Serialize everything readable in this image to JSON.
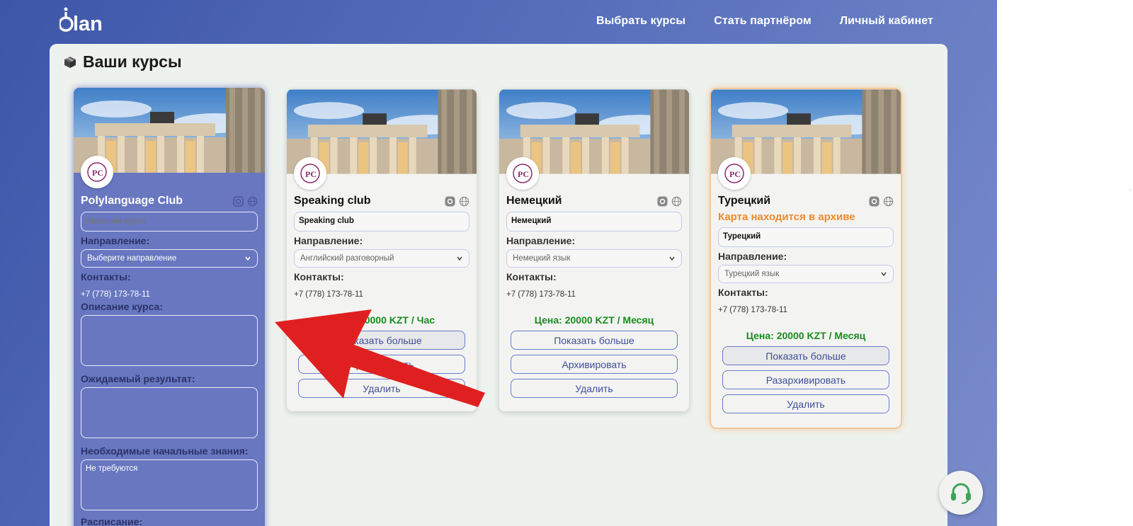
{
  "header": {
    "logo_text": "olan",
    "nav": [
      "Выбрать курсы",
      "Стать партнёром",
      "Личный кабинет"
    ]
  },
  "page": {
    "title": "Ваши курсы",
    "title_icon": "package-icon"
  },
  "labels": {
    "direction": "Направление:",
    "contacts": "Контакты:",
    "description": "Описание курса:",
    "expected_result": "Ожидаемый результат:",
    "prior_knowledge": "Необходимые начальные знания:",
    "schedule": "Расписание:",
    "show_more": "Показать больше",
    "archive": "Архивировать",
    "unarchive": "Разархивировать",
    "delete": "Удалить"
  },
  "cards": [
    {
      "name": "Polylanguage Club",
      "name_placeholder": "Название курса",
      "direction": "Выберите направление",
      "phone": "+7 (778) 173-78-11",
      "description": "",
      "expected_result": "",
      "prior_knowledge": "Не требуются"
    },
    {
      "name": "Speaking club",
      "name_value": "Speaking club",
      "direction": "Английский разговорный",
      "phone": "+7 (778) 173-78-11",
      "price": "Цена: 20000 KZT / Час"
    },
    {
      "name": "Немецкий",
      "name_value": "Немецкий",
      "direction": "Немецкий язык",
      "phone": "+7 (778) 173-78-11",
      "price": "Цена: 20000 KZT / Месяц"
    },
    {
      "name": "Турецкий",
      "archive_note": "Карта находится в архиве",
      "name_value": "Турецкий",
      "direction": "Турецкий язык",
      "phone": "+7 (778) 173-78-11",
      "price": "Цена: 20000 KZT / Месяц"
    }
  ],
  "colors": {
    "accent": "#5a72bd",
    "price_green": "#1a8a1e",
    "archive_orange": "#f08a2c",
    "annotation_arrow": "#e02020"
  },
  "support_icon": "headset-icon"
}
